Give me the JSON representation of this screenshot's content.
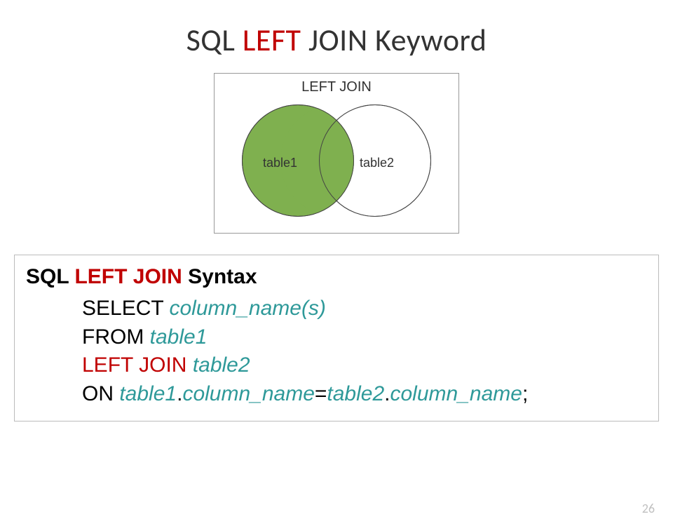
{
  "title": {
    "prefix": "SQL ",
    "highlight": "LEFT",
    "suffix": " JOIN Keyword"
  },
  "venn": {
    "heading": "LEFT JOIN",
    "left_label": "table1",
    "right_label": "table2"
  },
  "syntax": {
    "heading_prefix": "SQL ",
    "heading_highlight": "LEFT JOIN",
    "heading_suffix": " Syntax",
    "line1_kw": "SELECT ",
    "line1_val": "column_name(s)",
    "line2_kw": "FROM ",
    "line2_val": "table1",
    "line3_kw": "LEFT JOIN ",
    "line3_val": "table2",
    "line4_kw": "ON ",
    "line4_v1": "table1",
    "line4_dot1": ".",
    "line4_v2": "column_name",
    "line4_eq": "=",
    "line4_v3": "table2",
    "line4_dot2": ".",
    "line4_v4": "column_name",
    "line4_semi": ";"
  },
  "page_number": "26"
}
